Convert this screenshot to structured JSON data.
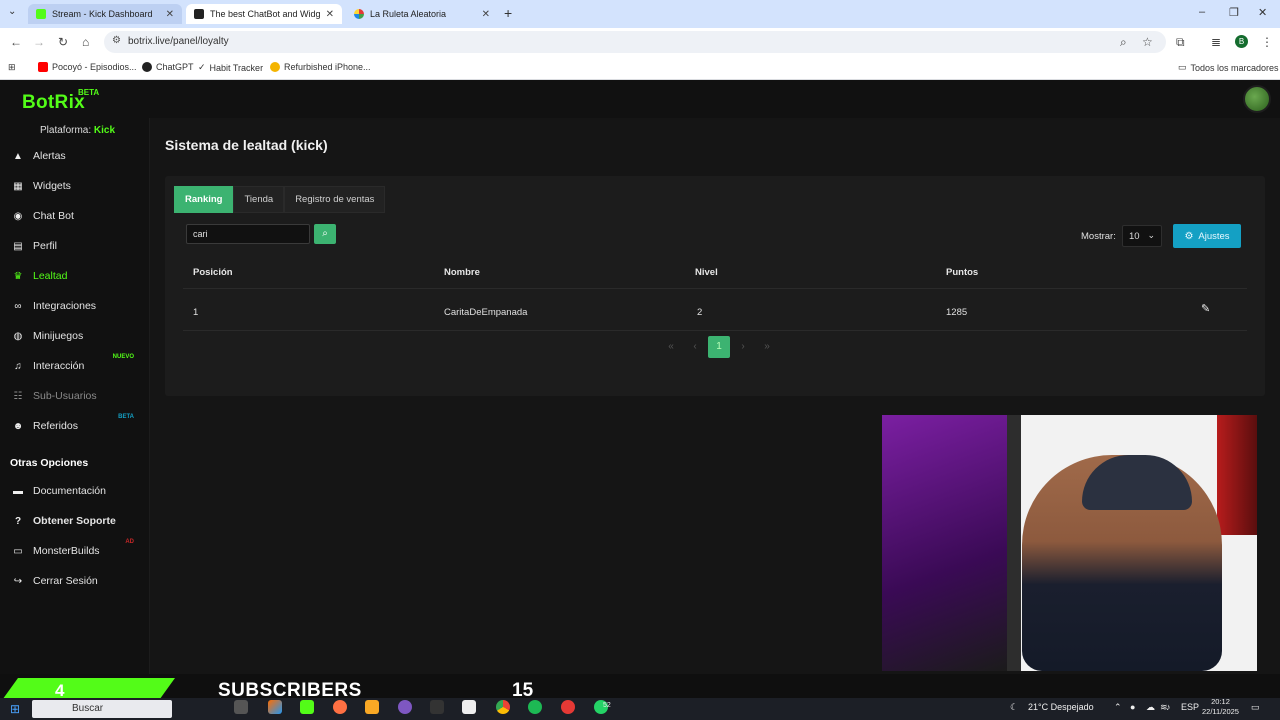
{
  "browser": {
    "tabs": [
      {
        "label": "Stream - Kick Dashboard",
        "icon": "kick-icon",
        "state": "hover"
      },
      {
        "label": "The best ChatBot and Widgets",
        "icon": "botrix-icon",
        "state": "active"
      },
      {
        "label": "La Ruleta Aleatoria",
        "icon": "wheel-icon",
        "state": "normal"
      }
    ],
    "url": "botrix.live/panel/loyalty",
    "bookmarks": [
      {
        "label": "Pocoyó - Episodios...",
        "icon": "youtube-icon",
        "color": "#ff0000"
      },
      {
        "label": "ChatGPT",
        "icon": "chatgpt-icon",
        "color": "#222222"
      },
      {
        "label": "Habit Tracker",
        "icon": "check-icon",
        "color": "#222222"
      },
      {
        "label": "Refurbished iPhone...",
        "icon": "apple-icon",
        "color": "#f4b400"
      }
    ],
    "all_bookmarks_label": "Todos los marcadores",
    "profile_initial": "B"
  },
  "app": {
    "logo": "BotRix",
    "logo_badge": "BETA",
    "accent_color": "#53fc18",
    "platform_label": "Plataforma:",
    "platform_value": "Kick",
    "nav": [
      {
        "label": "Alertas",
        "icon": "alert-triangle-icon"
      },
      {
        "label": "Widgets",
        "icon": "grid-icon"
      },
      {
        "label": "Chat Bot",
        "icon": "robot-icon"
      },
      {
        "label": "Perfil",
        "icon": "id-card-icon"
      },
      {
        "label": "Lealtad",
        "icon": "trophy-icon",
        "active": true
      },
      {
        "label": "Integraciones",
        "icon": "link-icon"
      },
      {
        "label": "Minijuegos",
        "icon": "gamepad-icon"
      },
      {
        "label": "Interacción",
        "icon": "music-note-icon",
        "badge": "NUEVO"
      },
      {
        "label": "Sub-Usuarios",
        "icon": "users-icon",
        "muted": true
      },
      {
        "label": "Referidos",
        "icon": "user-plus-icon",
        "badge": "BETA"
      }
    ],
    "other_section_title": "Otras Opciones",
    "other": [
      {
        "label": "Documentación",
        "icon": "book-icon"
      },
      {
        "label": "Obtener Soporte",
        "icon": "help-circle-icon"
      },
      {
        "label": "MonsterBuilds",
        "icon": "monitor-icon",
        "badge": "AD"
      },
      {
        "label": "Cerrar Sesión",
        "icon": "sign-out-icon"
      }
    ]
  },
  "page": {
    "title": "Sistema de lealtad (kick)",
    "tabs": [
      "Ranking",
      "Tienda",
      "Registro de ventas"
    ],
    "active_tab": 0,
    "search_value": "cari",
    "show_label": "Mostrar:",
    "per_page": "10",
    "settings_label": "Ajustes",
    "columns": [
      "Posición",
      "Nombre",
      "Nivel",
      "Puntos"
    ],
    "rows": [
      {
        "position": "1",
        "name": "CaritaDeEmpanada",
        "level": "2",
        "points": "1285"
      }
    ],
    "pagination": {
      "current": "1"
    }
  },
  "overlay": {
    "subs_count": "4",
    "subs_label": "SUBSCRIBERS",
    "subs_goal": "15"
  },
  "taskbar": {
    "search_label": "Buscar",
    "weather": "21°C Despejado",
    "lang": "ESP",
    "time": "20:12",
    "date": "22/11/2025",
    "whatsapp_badge": "52"
  }
}
